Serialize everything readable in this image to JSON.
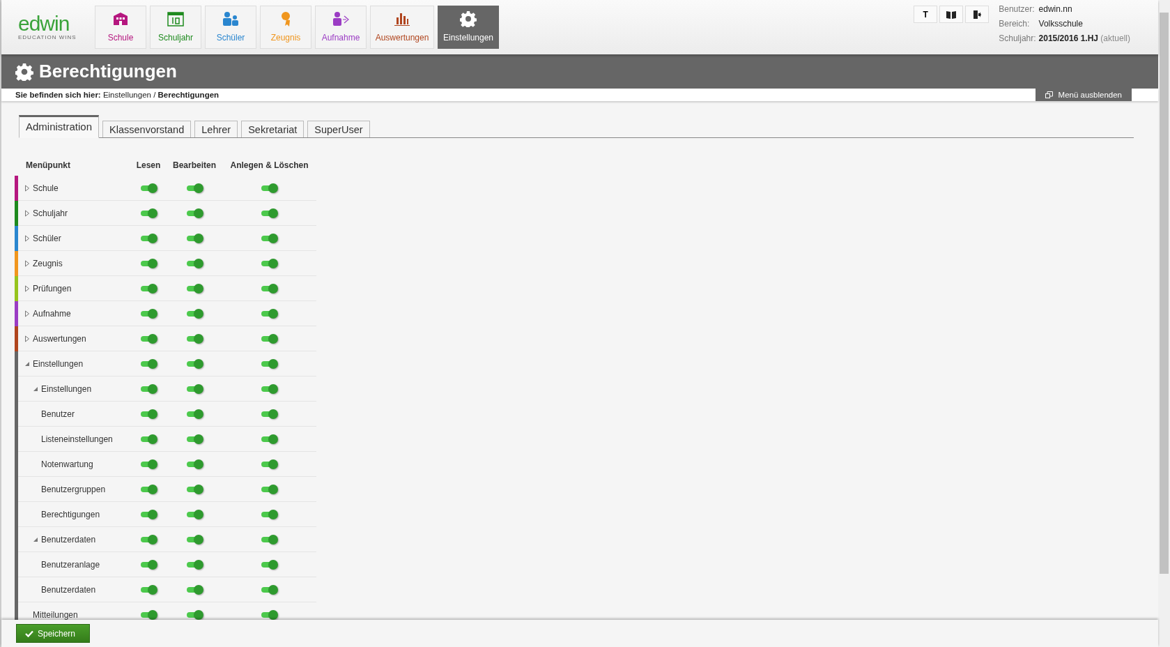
{
  "logo": {
    "name": "edwin",
    "tagline": "EDUCATION WINS"
  },
  "nav": [
    {
      "label": "Schule",
      "color": "#b5177f",
      "selected": false
    },
    {
      "label": "Schuljahr",
      "color": "#1e8a1e",
      "selected": false
    },
    {
      "label": "Schüler",
      "color": "#2a86cf",
      "selected": false
    },
    {
      "label": "Zeugnis",
      "color": "#f0961e",
      "selected": false
    },
    {
      "label": "Aufnahme",
      "color": "#9b3cc4",
      "selected": false
    },
    {
      "label": "Auswertungen",
      "color": "#b0451e",
      "selected": false
    },
    {
      "label": "Einstellungen",
      "color": "#ffffff",
      "selected": true
    }
  ],
  "toolbar": [
    {
      "label": "T"
    },
    {
      "kind": "book"
    },
    {
      "kind": "logout"
    }
  ],
  "user_info": [
    {
      "label": "Benutzer:",
      "value": "edwin.nn"
    },
    {
      "label": "Bereich:",
      "value": "Volksschule"
    },
    {
      "label": "Schuljahr:",
      "value": "**2015/2016 1.HJ** (aktuell)"
    }
  ],
  "page_title": "Berechtigungen",
  "breadcrumb": "**Sie befinden sich hier:** Einstellungen / **Berechtigungen**",
  "hide_menu": "Menü ausblenden",
  "tabs": [
    {
      "label": "Administration",
      "selected": true
    },
    {
      "label": "Klassenvorstand",
      "selected": false
    },
    {
      "label": "Lehrer",
      "selected": false
    },
    {
      "label": "Sekretariat",
      "selected": false
    },
    {
      "label": "SuperUser",
      "selected": false
    }
  ],
  "columns": [
    "Menüpunkt",
    "Lesen",
    "Bearbeiten",
    "Anlegen & Löschen"
  ],
  "tree": [
    {
      "label": "Schule",
      "color": "#b5177f",
      "expanded": false,
      "read": true,
      "edit": true,
      "create": true
    },
    {
      "label": "Schuljahr",
      "color": "#1e8a1e",
      "expanded": false,
      "read": true,
      "edit": true,
      "create": true
    },
    {
      "label": "Schüler",
      "color": "#2a86cf",
      "expanded": false,
      "read": true,
      "edit": true,
      "create": true
    },
    {
      "label": "Zeugnis",
      "color": "#f0961e",
      "expanded": false,
      "read": true,
      "edit": true,
      "create": true
    },
    {
      "label": "Prüfungen",
      "color": "#96c41e",
      "expanded": false,
      "read": true,
      "edit": true,
      "create": true
    },
    {
      "label": "Aufnahme",
      "color": "#9b3cc4",
      "expanded": false,
      "read": true,
      "edit": true,
      "create": true
    },
    {
      "label": "Auswertungen",
      "color": "#b0451e",
      "expanded": false,
      "read": true,
      "edit": true,
      "create": true
    },
    {
      "label": "Einstellungen",
      "color": "#666666",
      "expanded": true,
      "read": true,
      "edit": true,
      "create": true,
      "children": [
        {
          "label": "Einstellungen",
          "expanded": true,
          "read": true,
          "edit": true,
          "create": true,
          "children": [
            {
              "label": "Benutzer",
              "read": true,
              "edit": true,
              "create": true
            },
            {
              "label": "Listeneinstellungen",
              "read": true,
              "edit": true,
              "create": true
            },
            {
              "label": "Notenwartung",
              "read": true,
              "edit": true,
              "create": true
            },
            {
              "label": "Benutzergruppen",
              "read": true,
              "edit": true,
              "create": true
            },
            {
              "label": "Berechtigungen",
              "read": true,
              "edit": true,
              "create": true
            }
          ]
        },
        {
          "label": "Benutzerdaten",
          "expanded": true,
          "read": true,
          "edit": true,
          "create": true,
          "children": [
            {
              "label": "Benutzeranlage",
              "read": true,
              "edit": true,
              "create": true
            },
            {
              "label": "Benutzerdaten",
              "read": true,
              "edit": true,
              "create": true
            }
          ]
        },
        {
          "label": "Mitteilungen",
          "read": true,
          "edit": true,
          "create": true
        }
      ]
    }
  ],
  "save_button": "Speichern"
}
